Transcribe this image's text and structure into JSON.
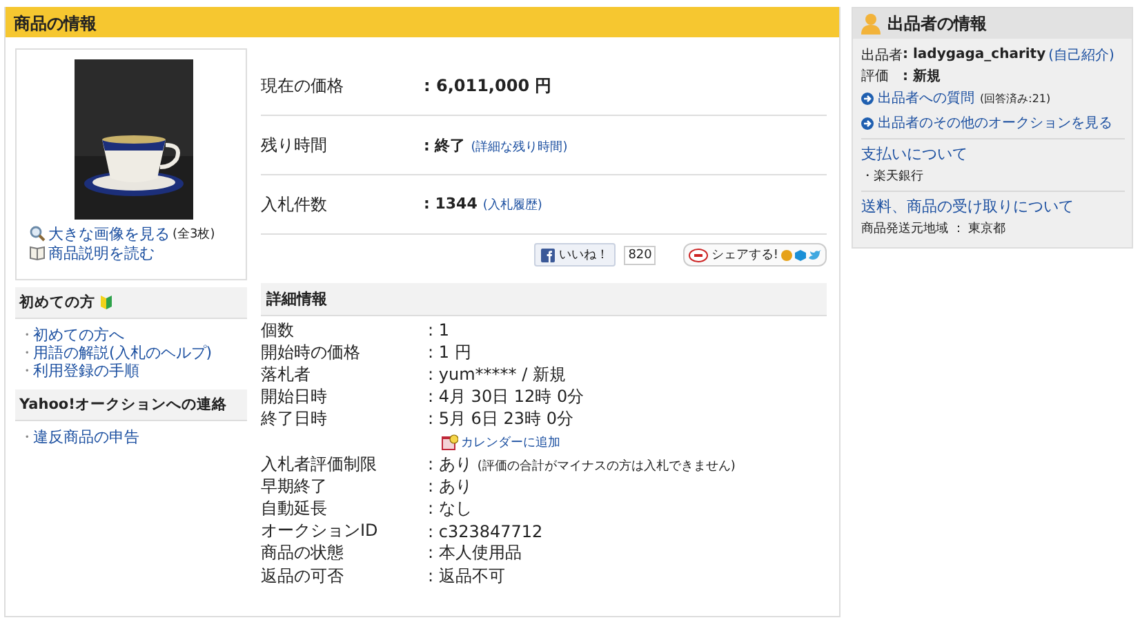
{
  "item_panel": {
    "title": "商品の情報",
    "image_links": [
      {
        "kind": "zoom",
        "label": "大きな画像を見る",
        "note": "(全3枚)"
      },
      {
        "kind": "book",
        "label": "商品説明を読む"
      }
    ],
    "summary": [
      {
        "label": "現在の価格",
        "value": ": 6,011,000 円"
      },
      {
        "label": "残り時間",
        "value": ": 終了",
        "link": "(詳細な残り時間)"
      },
      {
        "label": "入札件数",
        "value": ": 1344",
        "link": "(入札履歴)"
      }
    ],
    "social": {
      "like": "いいね！",
      "like_count": "820",
      "share": "シェアする!"
    },
    "sidebar_sections": [
      {
        "title": "初めての方",
        "beginner_mark": true,
        "links": [
          {
            "bullet": "・",
            "label": "初めての方へ"
          },
          {
            "bullet": "・",
            "label": "用語の解説(入札のヘルプ)"
          },
          {
            "bullet": "・",
            "label": "利用登録の手順"
          }
        ]
      },
      {
        "title": "Yahoo!オークションへの連絡",
        "beginner_mark": false,
        "links": [
          {
            "bullet": "・",
            "label": "違反商品の申告"
          }
        ]
      }
    ],
    "details": {
      "title": "詳細情報",
      "rows": [
        {
          "label": "個数",
          "value": ": 1"
        },
        {
          "label": "開始時の価格",
          "value": ": 1 円"
        },
        {
          "label": "落札者",
          "value": ": yum***** / 新規"
        },
        {
          "label": "開始日時",
          "value": ": 4月 30日 12時 0分"
        },
        {
          "label": "終了日時",
          "value": ": 5月 6日 23時 0分",
          "action": "カレンダーに追加"
        },
        {
          "label": "入札者評価制限",
          "value": ": あり",
          "note": "(評価の合計がマイナスの方は入札できません)"
        },
        {
          "label": "早期終了",
          "value": ": あり"
        },
        {
          "label": "自動延長",
          "value": ": なし"
        },
        {
          "label": "オークションID",
          "value": ": c323847712"
        },
        {
          "label": "商品の状態",
          "value": ": 本人使用品"
        },
        {
          "label": "返品の可否",
          "value": ": 返品不可"
        }
      ]
    }
  },
  "seller": {
    "title": "出品者の情報",
    "fields": [
      {
        "label": "出品者",
        "value": ": ladygaga_charity",
        "link": "(自己紹介)"
      },
      {
        "label": "評価",
        "value": ": 新規"
      }
    ],
    "links": [
      {
        "label": "出品者への質問",
        "note": "(回答済み:21)"
      },
      {
        "label": "出品者のその他のオークションを見る"
      }
    ],
    "sections": [
      {
        "title": "支払いについて",
        "lines": [
          "・楽天銀行"
        ]
      },
      {
        "title": "送料、商品の受け取りについて",
        "lines": [
          "商品発送元地域 ： 東京都"
        ]
      }
    ]
  }
}
